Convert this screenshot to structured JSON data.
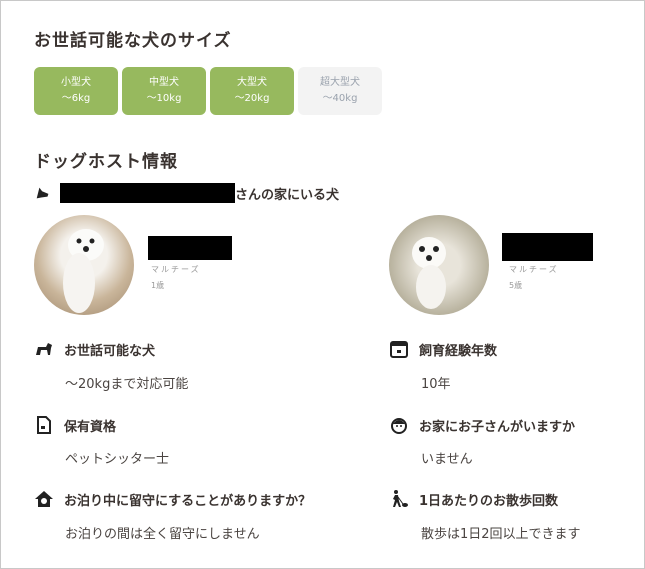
{
  "size_section": {
    "title": "お世話可能な犬のサイズ",
    "sizes": [
      {
        "name": "小型犬",
        "weight": "〜6kg",
        "active": true
      },
      {
        "name": "中型犬",
        "weight": "〜10kg",
        "active": true
      },
      {
        "name": "大型犬",
        "weight": "〜20kg",
        "active": true
      },
      {
        "name": "超大型犬",
        "weight": "〜40kg",
        "active": false
      }
    ],
    "active_color": "#97b95e"
  },
  "host_section": {
    "title": "ドッグホスト情報",
    "dogs_suffix": "さんの家にいる犬",
    "dogs": [
      {
        "breed": "マルチーズ",
        "age": "1歳"
      },
      {
        "breed": "マルチーズ",
        "age": "5歳"
      }
    ]
  },
  "info": [
    {
      "icon": "dog-icon",
      "label": "お世話可能な犬",
      "value": "〜20kgまで対応可能"
    },
    {
      "icon": "calendar-icon",
      "label": "飼育経験年数",
      "value": "10年"
    },
    {
      "icon": "certificate-icon",
      "label": "保有資格",
      "value": "ペットシッター士"
    },
    {
      "icon": "child-face-icon",
      "label": "お家にお子さんがいますか",
      "value": "いません"
    },
    {
      "icon": "house-icon",
      "label": "お泊り中に留守にすることがありますか？",
      "value": "お泊りの間は全く留守にしません"
    },
    {
      "icon": "dog-walk-icon",
      "label": "1日あたりのお散歩回数",
      "value": "散歩は1日2回以上できます"
    }
  ]
}
